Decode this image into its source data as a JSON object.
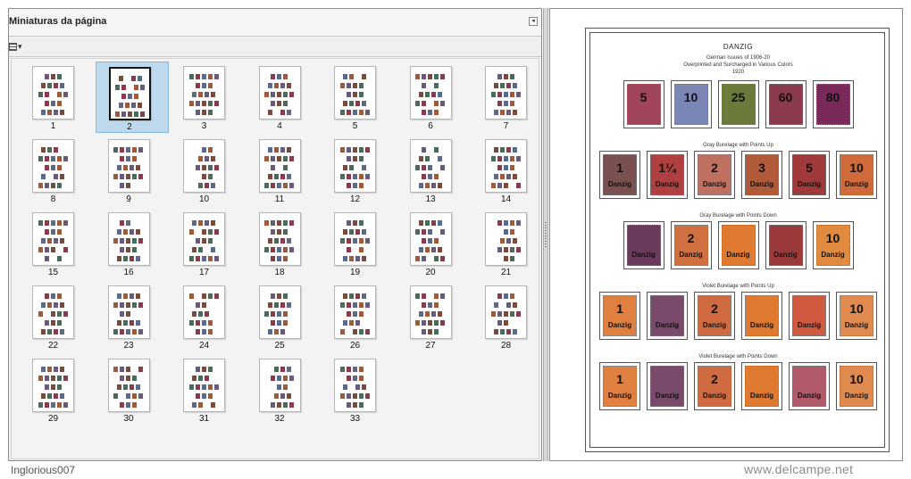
{
  "panel": {
    "title": "Miniaturas da página",
    "collapse_icon": "◂",
    "options_caret": "▾"
  },
  "thumbnails": [
    {
      "n": "1"
    },
    {
      "n": "2",
      "selected": true
    },
    {
      "n": "3"
    },
    {
      "n": "4"
    },
    {
      "n": "5"
    },
    {
      "n": "6"
    },
    {
      "n": "7"
    },
    {
      "n": "8"
    },
    {
      "n": "9"
    },
    {
      "n": "10"
    },
    {
      "n": "11"
    },
    {
      "n": "12"
    },
    {
      "n": "13"
    },
    {
      "n": "14"
    },
    {
      "n": "15"
    },
    {
      "n": "16"
    },
    {
      "n": "17"
    },
    {
      "n": "18"
    },
    {
      "n": "19"
    },
    {
      "n": "20"
    },
    {
      "n": "21"
    },
    {
      "n": "22"
    },
    {
      "n": "23"
    },
    {
      "n": "24"
    },
    {
      "n": "25"
    },
    {
      "n": "26"
    },
    {
      "n": "27"
    },
    {
      "n": "28"
    },
    {
      "n": "29"
    },
    {
      "n": "30"
    },
    {
      "n": "31"
    },
    {
      "n": "32"
    },
    {
      "n": "33"
    }
  ],
  "page": {
    "heading": "DANZIG",
    "subtitle_1": "German Issues of 1906-20",
    "subtitle_2": "Overprinted and Surcharged in Various Colors",
    "subtitle_3": "1920",
    "rows": [
      {
        "caption": "",
        "stamps": [
          {
            "num": "5",
            "color": "#a0445a"
          },
          {
            "num": "10",
            "color": "#7a86b5"
          },
          {
            "num": "25",
            "color": "#6a7a3a"
          },
          {
            "num": "60",
            "color": "#8a3a4a"
          },
          {
            "num": "80",
            "color": "#7a2a5a"
          }
        ]
      },
      {
        "caption": "Gray Burelage with Points Up",
        "stamps": [
          {
            "num": "1",
            "color": "#7a5050"
          },
          {
            "num": "1¼",
            "color": "#b04040"
          },
          {
            "num": "2",
            "color": "#c07060"
          },
          {
            "num": "3",
            "color": "#b05a3a"
          },
          {
            "num": "5",
            "color": "#a03a3a"
          },
          {
            "num": "10",
            "color": "#d06a3a"
          }
        ]
      },
      {
        "caption": "Gray Burelage with Points Down",
        "stamps": [
          {
            "num": "",
            "color": "#6a3a5a"
          },
          {
            "num": "2",
            "color": "#d07040"
          },
          {
            "num": "",
            "color": "#e07a30"
          },
          {
            "num": "",
            "color": "#9a3a3a"
          },
          {
            "num": "10",
            "color": "#e08a40"
          }
        ]
      },
      {
        "caption": "Violet Burelage with Points Up",
        "stamps": [
          {
            "num": "1",
            "color": "#e08040"
          },
          {
            "num": "",
            "color": "#7a4a6a"
          },
          {
            "num": "2",
            "color": "#d06a40"
          },
          {
            "num": "",
            "color": "#e07a30"
          },
          {
            "num": "",
            "color": "#d05a40"
          },
          {
            "num": "10",
            "color": "#e08a50"
          }
        ]
      },
      {
        "caption": "Violet Burelage with Points Down",
        "stamps": [
          {
            "num": "1",
            "color": "#e08040"
          },
          {
            "num": "",
            "color": "#7a4a6a"
          },
          {
            "num": "2",
            "color": "#d06a40"
          },
          {
            "num": "",
            "color": "#e07a30"
          },
          {
            "num": "",
            "color": "#b05a6a"
          },
          {
            "num": "10",
            "color": "#e08a50"
          }
        ]
      }
    ],
    "overprint": "Danzig"
  },
  "footer": {
    "username": "Inglorious007",
    "site": "www.delcampe.net"
  }
}
